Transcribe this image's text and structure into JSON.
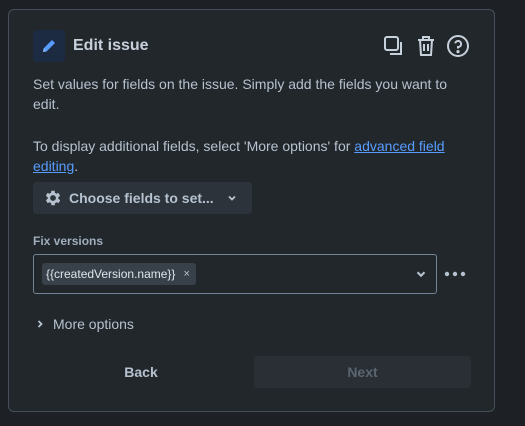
{
  "header": {
    "title": "Edit issue",
    "icon": "pencil-icon",
    "actions": [
      "duplicate-icon",
      "delete-icon",
      "help-icon"
    ]
  },
  "description": {
    "p1": "Set values for fields on the issue. Simply add the fields you want to edit.",
    "p2_prefix": "To display additional fields, select 'More options' for ",
    "p2_link": "advanced field editing",
    "p2_suffix": "."
  },
  "choose_fields": {
    "label": "Choose fields to set..."
  },
  "fix_versions": {
    "label": "Fix versions",
    "chip": "{{createdVersion.name}}",
    "chip_remove": "×"
  },
  "more_options": {
    "label": "More options"
  },
  "footer": {
    "back_label": "Back",
    "next_label": "Next"
  },
  "colors": {
    "background": "#1d2125",
    "panel": "#22272b",
    "link": "#579dff",
    "accent_icon": "#579dff"
  }
}
